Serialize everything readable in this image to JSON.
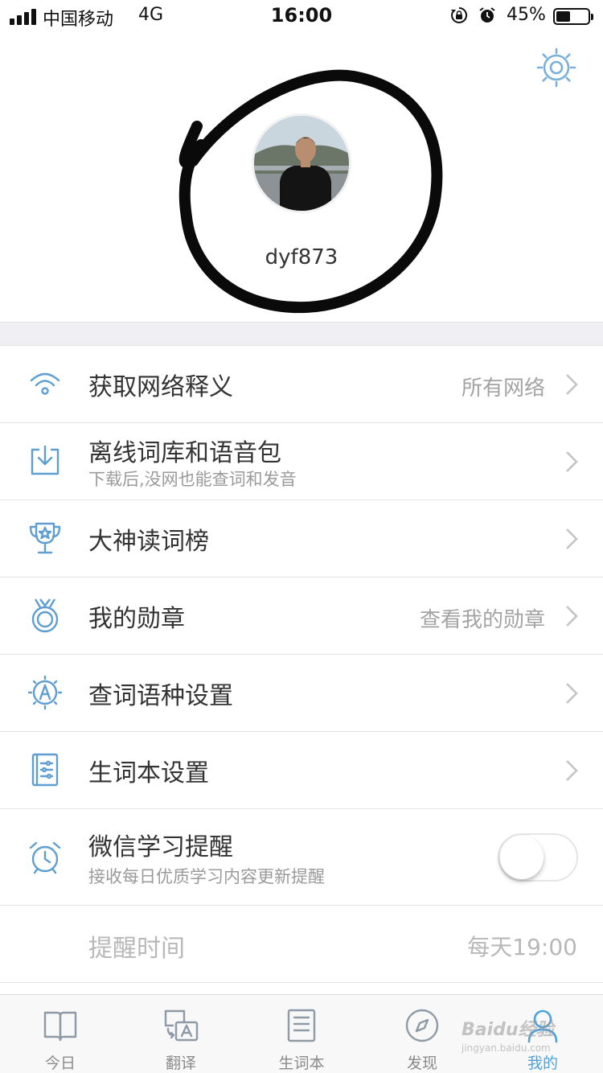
{
  "status_bar": {
    "carrier": "中国移动",
    "network": "4G",
    "time": "16:00",
    "battery_percent": "45%",
    "battery_level": 0.45
  },
  "profile": {
    "username": "dyf873"
  },
  "menu": [
    {
      "id": "network",
      "icon": "wifi-icon",
      "title": "获取网络释义",
      "value": "所有网络"
    },
    {
      "id": "offline",
      "icon": "download-icon",
      "title": "离线词库和语音包",
      "subtitle": "下载后,没网也能查词和发音"
    },
    {
      "id": "ranking",
      "icon": "trophy-icon",
      "title": "大神读词榜"
    },
    {
      "id": "medals",
      "icon": "medal-icon",
      "title": "我的勋章",
      "value": "查看我的勋章"
    },
    {
      "id": "language",
      "icon": "language-icon",
      "title": "查词语种设置"
    },
    {
      "id": "wordbook",
      "icon": "wordbook-settings-icon",
      "title": "生词本设置"
    },
    {
      "id": "wechat",
      "icon": "alarm-clock-icon",
      "title": "微信学习提醒",
      "subtitle": "接收每日优质学习内容更新提醒",
      "toggle_on": false
    },
    {
      "id": "remind_time",
      "title": "提醒时间",
      "value": "每天19:00"
    }
  ],
  "tabs": [
    {
      "label": "今日",
      "icon": "book-icon",
      "active": false
    },
    {
      "label": "翻译",
      "icon": "translate-icon",
      "active": false
    },
    {
      "label": "生词本",
      "icon": "notebook-icon",
      "active": false
    },
    {
      "label": "发现",
      "icon": "compass-icon",
      "active": false
    },
    {
      "label": "我的",
      "icon": "user-icon",
      "active": true
    }
  ],
  "watermark": {
    "text": "Baidu经验",
    "url_text": "jingyan.baidu.com"
  },
  "colors": {
    "accent": "#4aa3df",
    "icon_blue": "#5f9ed1",
    "background_band": "#efeff4"
  }
}
